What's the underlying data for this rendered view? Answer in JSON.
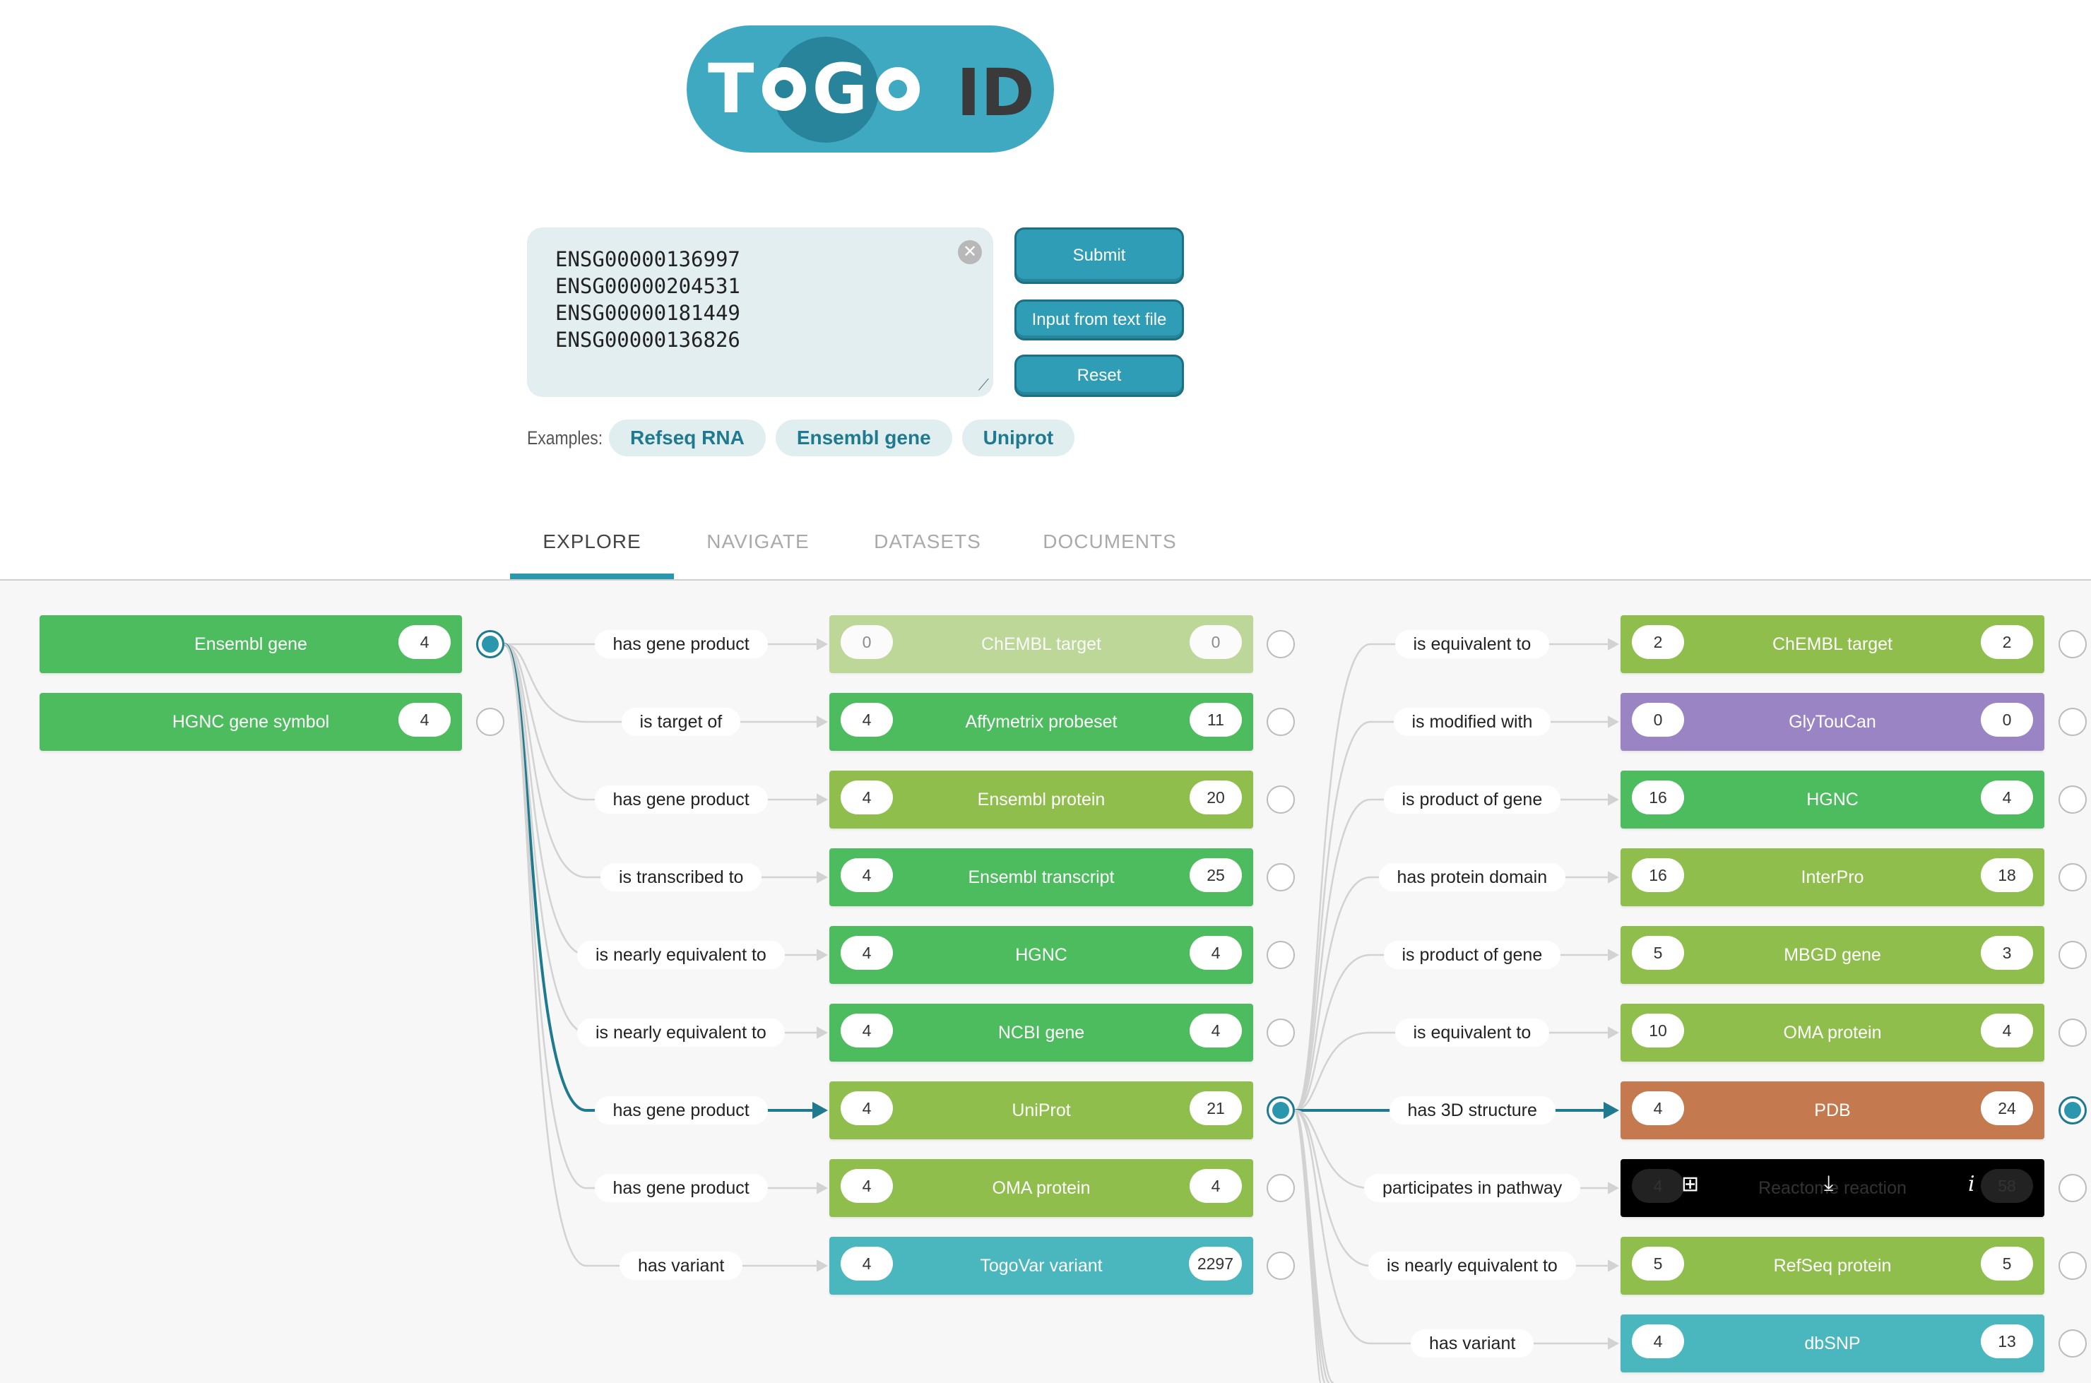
{
  "logo": {
    "togo": "TOGO",
    "id": "ID"
  },
  "input": {
    "lines": [
      "ENSG00000136997",
      "ENSG00000204531",
      "ENSG00000181449",
      "ENSG00000136826"
    ]
  },
  "buttons": {
    "submit": "Submit",
    "file": "Input from text file",
    "reset": "Reset"
  },
  "examples": {
    "label": "Examples:",
    "items": [
      "Refseq RNA",
      "Ensembl gene",
      "Uniprot"
    ]
  },
  "tabs": [
    "EXPLORE",
    "NAVIGATE",
    "DATASETS",
    "DOCUMENTS"
  ],
  "colors": {
    "green": "#4dbc5e",
    "olive": "#8fbe4c",
    "purple": "#9b84c4",
    "teal": "#4ab6bd",
    "brown": "#c47a4e",
    "accent": "#2b97ad"
  },
  "col0": [
    {
      "name": "Ensembl gene",
      "count": "4",
      "color": "green",
      "selected": true
    },
    {
      "name": "HGNC gene symbol",
      "count": "4",
      "color": "green",
      "selected": false
    }
  ],
  "col1": [
    {
      "rel": "has gene product",
      "name": "ChEMBL target",
      "left": "0",
      "right": "0",
      "color": "olive",
      "faded": true
    },
    {
      "rel": "is target of",
      "name": "Affymetrix probeset",
      "left": "4",
      "right": "11",
      "color": "green"
    },
    {
      "rel": "has gene product",
      "name": "Ensembl protein",
      "left": "4",
      "right": "20",
      "color": "olive"
    },
    {
      "rel": "is transcribed to",
      "name": "Ensembl transcript",
      "left": "4",
      "right": "25",
      "color": "green"
    },
    {
      "rel": "is nearly equivalent to",
      "name": "HGNC",
      "left": "4",
      "right": "4",
      "color": "green"
    },
    {
      "rel": "is nearly equivalent to",
      "name": "NCBI gene",
      "left": "4",
      "right": "4",
      "color": "green"
    },
    {
      "rel": "has gene product",
      "name": "UniProt",
      "left": "4",
      "right": "21",
      "color": "olive",
      "selected": true
    },
    {
      "rel": "has gene product",
      "name": "OMA protein",
      "left": "4",
      "right": "4",
      "color": "olive"
    },
    {
      "rel": "has variant",
      "name": "TogoVar variant",
      "left": "4",
      "right": "2297",
      "color": "teal"
    }
  ],
  "col2": [
    {
      "rel": "is equivalent to",
      "name": "ChEMBL target",
      "left": "2",
      "right": "2",
      "color": "olive"
    },
    {
      "rel": "is modified with",
      "name": "GlyTouCan",
      "left": "0",
      "right": "0",
      "color": "purple"
    },
    {
      "rel": "is product of gene",
      "name": "HGNC",
      "left": "16",
      "right": "4",
      "color": "green"
    },
    {
      "rel": "has protein domain",
      "name": "InterPro",
      "left": "16",
      "right": "18",
      "color": "olive"
    },
    {
      "rel": "is product of gene",
      "name": "MBGD gene",
      "left": "5",
      "right": "3",
      "color": "olive"
    },
    {
      "rel": "is equivalent to",
      "name": "OMA protein",
      "left": "10",
      "right": "4",
      "color": "olive"
    },
    {
      "rel": "has 3D structure",
      "name": "PDB",
      "left": "4",
      "right": "24",
      "color": "brown",
      "selected": true
    },
    {
      "rel": "participates in pathway",
      "name": "Reactome reaction",
      "left": "4",
      "right": "58",
      "color": "black",
      "tooltip": true
    },
    {
      "rel": "is nearly equivalent to",
      "name": "RefSeq protein",
      "left": "5",
      "right": "5",
      "color": "olive"
    },
    {
      "rel": "has variant",
      "name": "dbSNP",
      "left": "4",
      "right": "13",
      "color": "teal"
    }
  ]
}
